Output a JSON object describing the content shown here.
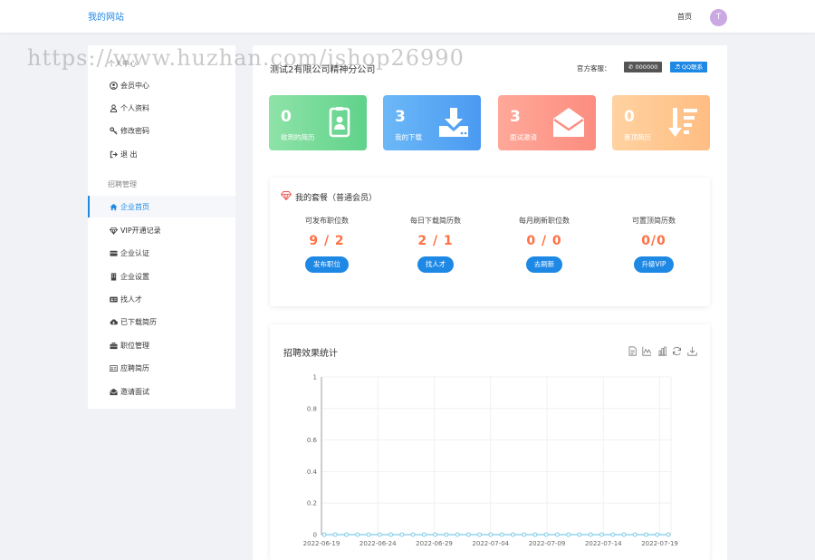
{
  "header": {
    "brand": "我的网站",
    "nav_home": "首页",
    "avatar_letter": "T"
  },
  "watermark": "https://www.huzhan.com/ishop26990",
  "sidebar": {
    "section_personal": "个人中心",
    "items_personal": [
      {
        "label": "会员中心",
        "icon": "user-circle-icon"
      },
      {
        "label": "个人资料",
        "icon": "user-icon"
      },
      {
        "label": "修改密码",
        "icon": "key-icon"
      },
      {
        "label": "退 出",
        "icon": "sign-out-icon"
      }
    ],
    "section_recruit": "招聘管理",
    "items_recruit": [
      {
        "label": "企业首页",
        "icon": "home-icon",
        "active": true
      },
      {
        "label": "VIP开通记录",
        "icon": "diamond-icon"
      },
      {
        "label": "企业认证",
        "icon": "id-card-icon"
      },
      {
        "label": "企业设置",
        "icon": "building-icon"
      },
      {
        "label": "找人才",
        "icon": "address-card-icon"
      },
      {
        "label": "已下载简历",
        "icon": "cloud-download-icon"
      },
      {
        "label": "职位管理",
        "icon": "briefcase-icon"
      },
      {
        "label": "应聘简历",
        "icon": "id-badge-icon"
      },
      {
        "label": "邀请面试",
        "icon": "envelope-open-icon"
      }
    ]
  },
  "main": {
    "company_name": "测试2有限公司精神分公司",
    "service_label": "官方客服：",
    "phone": "000000",
    "qq": "QQ联系",
    "stats": [
      {
        "value": "0",
        "label": "收到的简历",
        "color_from": "#8fe3a8",
        "color_to": "#5fd28a",
        "icon": "id-card-icon"
      },
      {
        "value": "3",
        "label": "我的下载",
        "color_from": "#6cb8f7",
        "color_to": "#4a9af2",
        "icon": "download-icon"
      },
      {
        "value": "3",
        "label": "面试邀请",
        "color_from": "#ffa89a",
        "color_to": "#fc8d7f",
        "icon": "envelope-open-icon"
      },
      {
        "value": "0",
        "label": "置顶简历",
        "color_from": "#ffd2a1",
        "color_to": "#ffbd82",
        "icon": "sort-amount-icon"
      }
    ],
    "package": {
      "title": "我的套餐（普通会员）",
      "columns": [
        {
          "title": "可发布职位数",
          "value": "9 / 2",
          "button": "发布职位"
        },
        {
          "title": "每日下载简历数",
          "value": "2 / 1",
          "button": "找人才"
        },
        {
          "title": "每月刷新职位数",
          "value": "0 / 0",
          "button": "去刷新"
        },
        {
          "title": "可置顶简历数",
          "value": "0/0",
          "button": "升级VIP"
        }
      ]
    },
    "chart_title": "招聘效果统计",
    "toolbar_icons": [
      "data-view-icon",
      "line-chart-icon",
      "bar-chart-icon",
      "restore-icon",
      "save-image-icon"
    ]
  },
  "colors": {
    "accent": "#1e88e5",
    "value_orange": "#ff7043",
    "series_line": "#7ecbe8"
  },
  "chart_data": {
    "type": "line",
    "title": "招聘效果统计",
    "xlabel": "",
    "ylabel": "",
    "ylim": [
      0,
      1
    ],
    "yticks": [
      "0",
      "0.2",
      "0.4",
      "0.6",
      "0.8",
      "1"
    ],
    "xtick_labels": [
      "2022-06-19",
      "2022-06-24",
      "2022-06-29",
      "2022-07-04",
      "2022-07-09",
      "2022-07-14",
      "2022-07-19"
    ],
    "x_start": "2022-06-19",
    "x_end": "2022-07-20",
    "grid": true,
    "series": [
      {
        "values": [
          0,
          0,
          0,
          0,
          0,
          0,
          0,
          0,
          0,
          0,
          0,
          0,
          0,
          0,
          0,
          0,
          0,
          0,
          0,
          0,
          0,
          0,
          0,
          0,
          0,
          0,
          0,
          0,
          0,
          0,
          0,
          0
        ]
      }
    ]
  }
}
